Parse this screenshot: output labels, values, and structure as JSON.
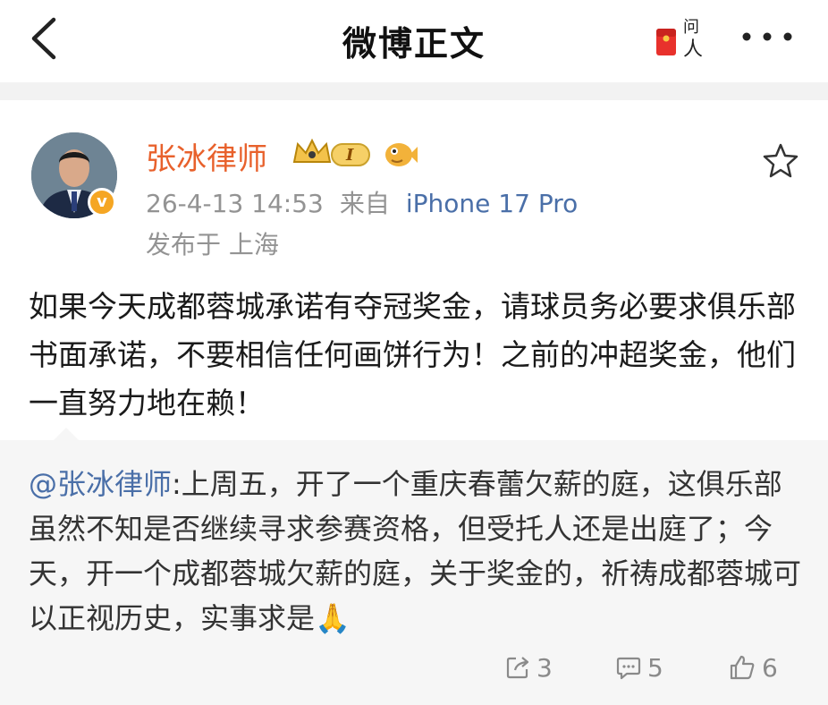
{
  "header": {
    "title": "微博正文",
    "wenren_label": "问人"
  },
  "post": {
    "author": "张冰律师",
    "level_badge": "I",
    "timestamp": "26-4-13 14:53",
    "source_prefix": "来自",
    "source": "iPhone 17 Pro",
    "location": "发布于 上海",
    "text": "如果今天成都蓉城承诺有夺冠奖金，请球员务必要求俱乐部书面承诺，不要相信任何画饼行为！之前的冲超奖金，他们一直努力地在赖！"
  },
  "retweet": {
    "mention": "@张冰律师",
    "text": ":上周五，开了一个重庆春蕾欠薪的庭，这俱乐部虽然不知是否继续寻求参赛资格，但受托人还是出庭了；今天，开一个成都蓉城欠薪的庭，关于奖金的，祈祷成都蓉城可以正视历史，实事求是",
    "emoji": "🙏",
    "reposts": "3",
    "comments": "5",
    "likes": "6"
  },
  "colors": {
    "author": "#e8612c",
    "link": "#4a6fa8",
    "meta": "#939393",
    "retweet_bg": "#f6f6f6"
  }
}
